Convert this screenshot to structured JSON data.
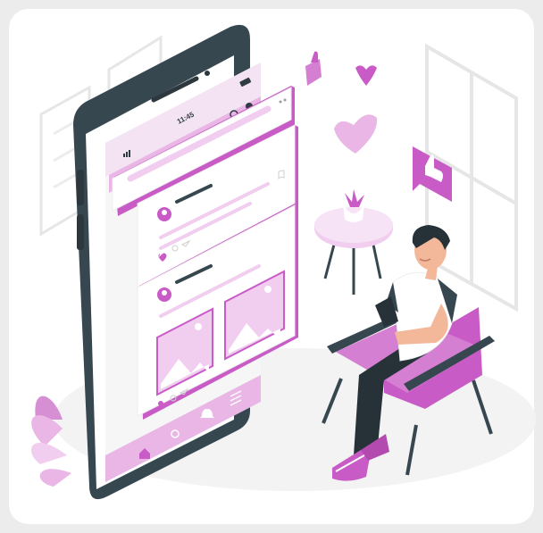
{
  "status_bar": {
    "time": "11:45"
  },
  "colors": {
    "accent": "#c95bc7",
    "accent_light": "#e9b6e6",
    "accent_pale": "#f6e3f5",
    "phone_frame": "#37474f",
    "skin": "#f3b89a",
    "hair": "#2b2b2b"
  },
  "icons": [
    "like-icon",
    "heart-icon",
    "thumbs-up-icon",
    "home-icon",
    "search-icon",
    "profile-icon",
    "bell-icon",
    "menu-icon",
    "bookmark-icon",
    "share-icon",
    "comment-icon",
    "image-icon"
  ]
}
